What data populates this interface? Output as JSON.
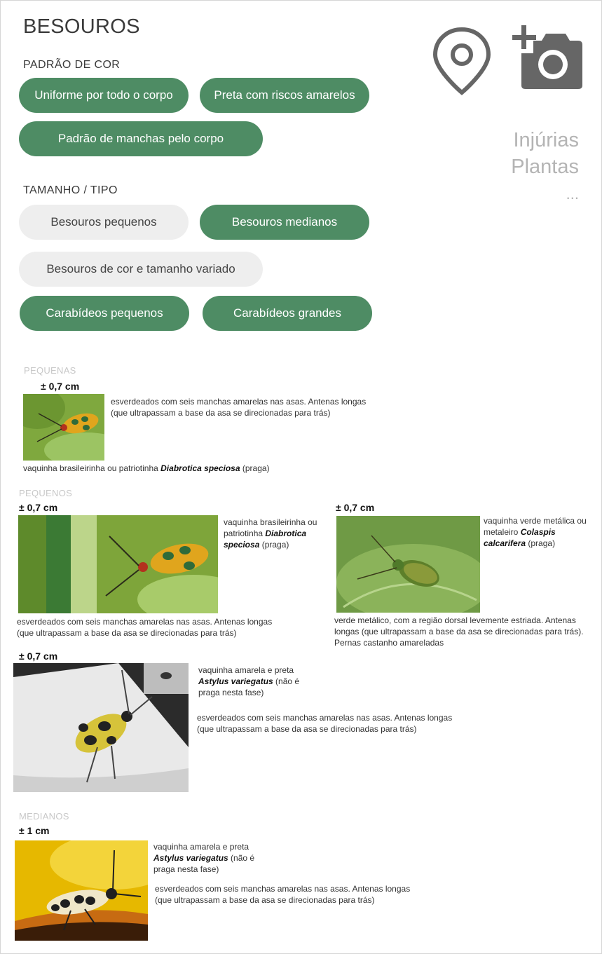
{
  "header": {
    "title": "BESOUROS",
    "location_icon": "map-pin-icon",
    "camera_icon": "add-photo-icon",
    "side_menu": [
      "Injúrias",
      "Plantas",
      "..."
    ]
  },
  "color_pattern": {
    "label": "PADRÃO DE COR",
    "chips": [
      {
        "label": "Uniforme por todo o corpo",
        "selected": true
      },
      {
        "label": "Preta com riscos amarelos",
        "selected": true
      },
      {
        "label": "Padrão de manchas pelo corpo",
        "selected": true
      }
    ]
  },
  "size_type": {
    "label": "TAMANHO / TIPO",
    "chips": [
      {
        "label": "Besouros pequenos",
        "selected": false
      },
      {
        "label": "Besouros medianos",
        "selected": true
      },
      {
        "label": "Besouros de cor e tamanho variado",
        "selected": false
      },
      {
        "label": "Carabídeos pequenos",
        "selected": true
      },
      {
        "label": "Carabídeos grandes",
        "selected": true
      }
    ]
  },
  "results": {
    "pequenas": {
      "heading": "PEQUENAS",
      "size": "± 0,7 cm",
      "description": "esverdeados com seis manchas amarelas nas asas. Antenas longas (que ultrapassam a base da asa se direcionadas para trás)",
      "name_prefix": "vaquinha brasileirinha ou patriotinha ",
      "name_sci": "Diabrotica speciosa",
      "name_suffix": " (praga)"
    },
    "pequenos": {
      "heading": "PEQUENOS",
      "cards": [
        {
          "size": "± 0,7 cm",
          "name_prefix": "vaquinha brasileirinha ou patriotinha ",
          "name_sci": "Diabrotica speciosa",
          "name_suffix": " (praga)",
          "description": "esverdeados com seis manchas amarelas nas asas. Antenas longas (que ultrapassam a base da asa se direcionadas para trás)"
        },
        {
          "size": "± 0,7 cm",
          "name_prefix": "vaquinha verde metálica ou metaleiro ",
          "name_sci": "Colaspis calcarifera",
          "name_suffix": " (praga)",
          "description": "verde metálico, com a região dorsal levemente estriada. Antenas longas (que ultrapassam a base da asa se direcionadas para trás). Pernas castanho amareladas"
        },
        {
          "size": "± 0,7 cm",
          "name_prefix": "vaquinha amarela e preta ",
          "name_sci": "Astylus variegatus",
          "name_suffix": " (não é praga nesta fase)",
          "description": "esverdeados com seis manchas amarelas nas asas. Antenas longas (que ultrapassam a base da asa se direcionadas para trás)"
        }
      ]
    },
    "medianos": {
      "heading": "MEDIANOS",
      "size": "± 1 cm",
      "name_prefix": "vaquinha amarela e preta ",
      "name_sci": "Astylus variegatus",
      "name_suffix": " (não é praga nesta fase)",
      "description": "esverdeados com seis manchas amarelas nas asas. Antenas longas (que ultrapassam a base da asa se direcionadas para trás)"
    }
  },
  "colors": {
    "chip_selected": "#4e8c64",
    "chip_unselected": "#eeeeee",
    "icon_gray": "#666666"
  }
}
